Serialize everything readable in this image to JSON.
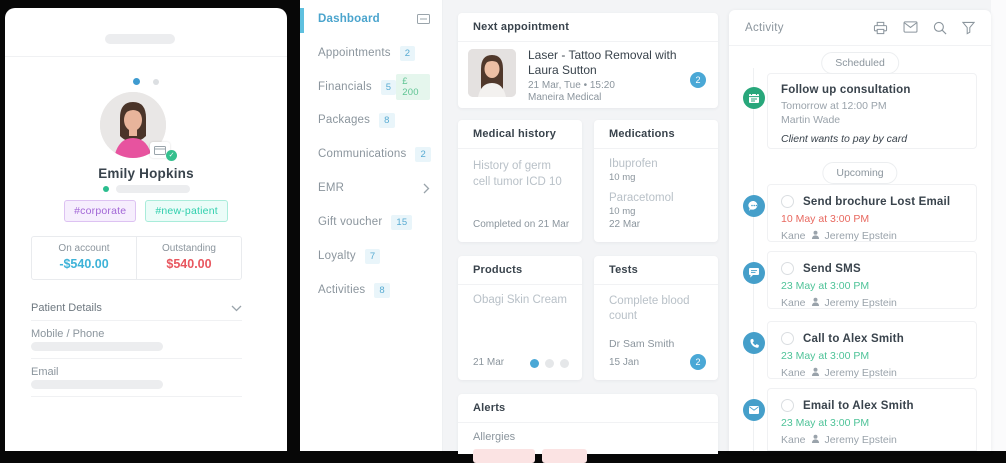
{
  "colors": {
    "accent_blue": "#4aa4cd",
    "badge_blue_bg": "#e9f5fa",
    "money_green": "#5ec493",
    "scheduled_green": "#28a77b",
    "alert_pink": "#fbe3e3",
    "on_account_teal": "#3eb3d8",
    "outstanding_red": "#e8575f",
    "time_red": "#e8685f",
    "time_green": "#4ec398"
  },
  "patient": {
    "name": "Emily Hopkins",
    "tags": [
      {
        "label": "#corporate"
      },
      {
        "label": "#new-patient"
      }
    ],
    "account": [
      {
        "label": "On account",
        "value": "-$540.00",
        "color": "#3eb3d8"
      },
      {
        "label": "Outstanding",
        "value": "$540.00",
        "color": "#e8575f"
      }
    ],
    "details_title": "Patient Details",
    "fields": [
      {
        "label": "Mobile / Phone"
      },
      {
        "label": "Email"
      }
    ]
  },
  "sidebar": {
    "items": [
      {
        "label": "Dashboard",
        "active": true,
        "trailing_icon": "card-icon"
      },
      {
        "label": "Appointments",
        "badge": "2"
      },
      {
        "label": "Financials",
        "badge": "5",
        "money_badge": "£ 200"
      },
      {
        "label": "Packages",
        "badge": "8"
      },
      {
        "label": "Communications",
        "badge": "2"
      },
      {
        "label": "EMR",
        "trailing_icon": "chevron-right-icon"
      },
      {
        "label": "Gift voucher",
        "badge": "15"
      },
      {
        "label": "Loyalty",
        "badge": "7"
      },
      {
        "label": "Activities",
        "badge": "8"
      }
    ]
  },
  "cards": {
    "next_appointment": {
      "title": "Next appointment",
      "appointment_title": "Laser - Tattoo Removal with Laura Sutton",
      "datetime": "21 Mar, Tue • 15:20",
      "location": "Maneira Medical",
      "badge": "2"
    },
    "medical_history": {
      "title": "Medical history",
      "entry": "History of germ cell tumor ICD 10",
      "footer": "Completed on 21 Mar"
    },
    "medications": {
      "title": "Medications",
      "items": [
        {
          "name": "Ibuprofen",
          "dose": "10 mg"
        },
        {
          "name": "Paracetomol",
          "dose": "10 mg"
        }
      ],
      "footer": "22 Mar"
    },
    "products": {
      "title": "Products",
      "entry": "Obagi Skin Cream",
      "footer": "21 Mar"
    },
    "tests": {
      "title": "Tests",
      "entry": "Complete blood count",
      "doctor": "Dr Sam Smith",
      "footer": "15 Jan",
      "badge": "2"
    },
    "alerts": {
      "title": "Alerts",
      "section_label": "Allergies"
    }
  },
  "activity": {
    "title": "Activity",
    "header_icons": [
      "printer-icon",
      "mail-icon",
      "search-icon",
      "filter-icon"
    ],
    "scheduled_label": "Scheduled",
    "upcoming_label": "Upcoming",
    "scheduled": [
      {
        "icon": "calendar-icon",
        "title": "Follow up consultation",
        "time": "Tomorrow at 12:00 PM",
        "person": "Martin Wade",
        "note": "Client wants to pay by card"
      }
    ],
    "upcoming": [
      {
        "icon": "chat-dots-icon",
        "title": "Send brochure Lost Email",
        "time": "10 May at 3:00 PM",
        "time_color": "#e8685f",
        "assignee": "Kane",
        "owner": "Jeremy Epstein"
      },
      {
        "icon": "sms-icon",
        "title": "Send SMS",
        "time": "23 May at 3:00 PM",
        "time_color": "#4ec398",
        "assignee": "Kane",
        "owner": "Jeremy Epstein"
      },
      {
        "icon": "phone-icon",
        "title": "Call to Alex Smith",
        "time": "23 May at 3:00 PM",
        "time_color": "#4ec398",
        "assignee": "Kane",
        "owner": "Jeremy Epstein"
      },
      {
        "icon": "envelope-icon",
        "title": "Email to Alex Smith",
        "time": "23 May at 3:00 PM",
        "time_color": "#4ec398",
        "assignee": "Kane",
        "owner": "Jeremy Epstein"
      }
    ]
  }
}
